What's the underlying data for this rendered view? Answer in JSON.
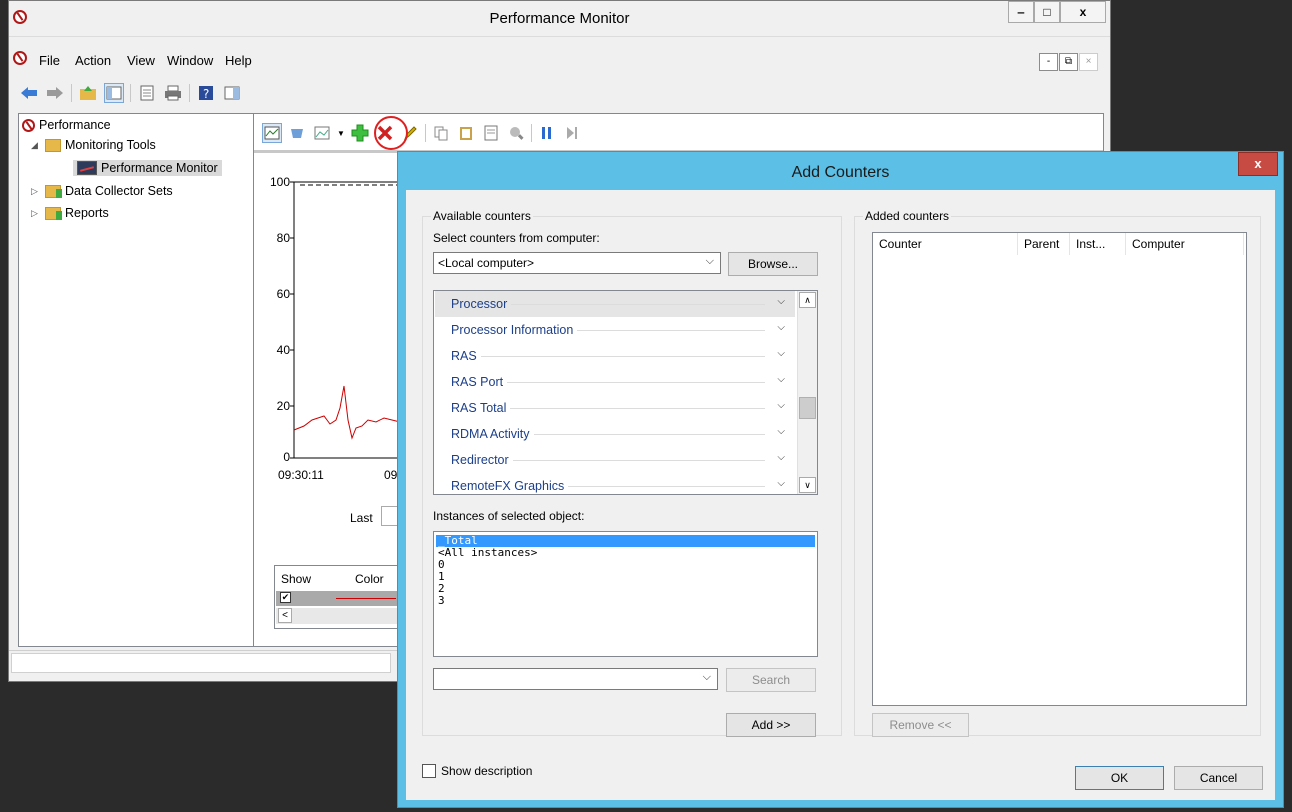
{
  "main_window": {
    "title": "Performance Monitor",
    "window_buttons": {
      "minimize": "‒",
      "maximize": "□",
      "close": "x"
    },
    "menu": [
      "File",
      "Action",
      "View",
      "Window",
      "Help"
    ],
    "mdi_buttons": {
      "minimize": "-",
      "restore": "⧉",
      "close": "×"
    }
  },
  "tree": {
    "root": "Performance",
    "items": [
      {
        "label": "Monitoring Tools",
        "expanded": true
      },
      {
        "label": "Performance Monitor",
        "selected": true
      },
      {
        "label": "Data Collector Sets",
        "expanded": false
      },
      {
        "label": "Reports",
        "expanded": false
      }
    ]
  },
  "graph": {
    "y_ticks": [
      "100",
      "80",
      "60",
      "40",
      "20",
      "0"
    ],
    "x_ticks": [
      "09:30:11",
      "09"
    ],
    "last_label": "Last",
    "line_color": "#cc0000"
  },
  "legend": {
    "headers": [
      "Show",
      "Color"
    ],
    "checked": "✔",
    "scroll_left": "<"
  },
  "dialog": {
    "title": "Add Counters",
    "close": "x",
    "available_group": "Available counters",
    "select_from_label": "Select counters from computer:",
    "computer_value": "<Local computer>",
    "browse_button": "Browse...",
    "counters": [
      {
        "name": "Processor",
        "selected": true
      },
      {
        "name": "Processor Information"
      },
      {
        "name": "RAS"
      },
      {
        "name": "RAS Port"
      },
      {
        "name": "RAS Total"
      },
      {
        "name": "RDMA Activity"
      },
      {
        "name": "Redirector"
      },
      {
        "name": "RemoteFX Graphics"
      }
    ],
    "instances_label": "Instances of selected object:",
    "instances": [
      {
        "name": "_Total",
        "selected": true
      },
      {
        "name": "<All instances>"
      },
      {
        "name": "0"
      },
      {
        "name": "1"
      },
      {
        "name": "2"
      },
      {
        "name": "3"
      }
    ],
    "search_button": "Search",
    "add_button": "Add >>",
    "added_group": "Added counters",
    "added_columns": [
      "Counter",
      "Parent",
      "Inst...",
      "Computer"
    ],
    "remove_button": "Remove <<",
    "show_description": "Show description",
    "ok_button": "OK",
    "cancel_button": "Cancel"
  }
}
